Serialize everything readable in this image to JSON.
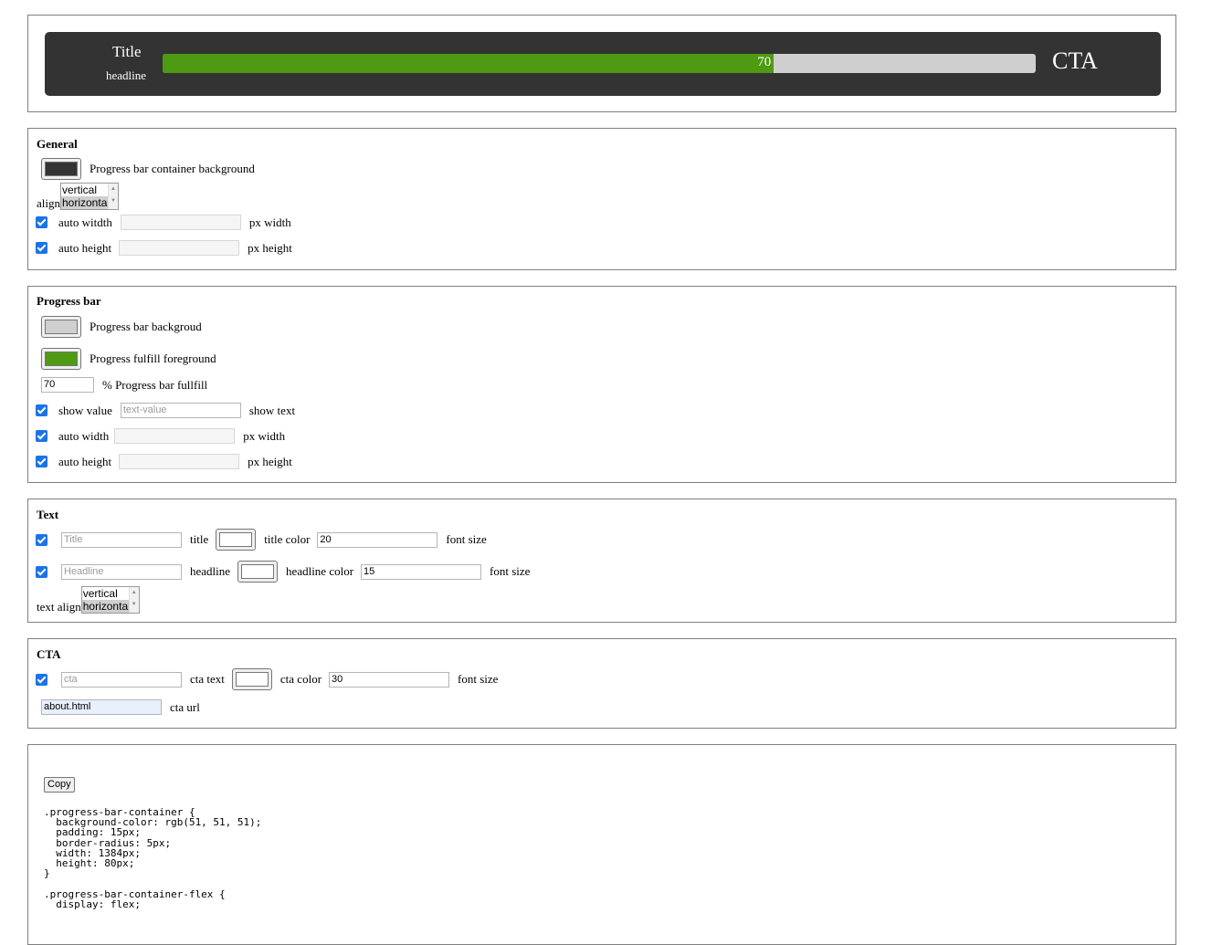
{
  "preview": {
    "title": "Title",
    "headline": "headline",
    "value": "70",
    "fill_percent": 70,
    "cta": "CTA",
    "colors": {
      "container": "#333333",
      "track": "#cfcfcf",
      "fill": "#4e9a13",
      "text": "#ffffff"
    }
  },
  "general": {
    "legend": "General",
    "container_bg_label": "Progress bar container background",
    "container_bg_color": "#333333",
    "align_label": "align",
    "align_options": [
      "vertical",
      "horizontal"
    ],
    "align_selected": "horizontal",
    "auto_width_label": "auto witdth",
    "px_width_label": "px width",
    "auto_height_label": "auto height",
    "px_height_label": "px height"
  },
  "progress": {
    "legend": "Progress bar",
    "bg_label": "Progress bar backgroud",
    "bg_color": "#cfcfcf",
    "fg_label": "Progress fulfill foreground",
    "fg_color": "#4e9a13",
    "fullfill_value": "70",
    "fullfill_label": "% Progress bar fullfill",
    "show_value_label": "show value",
    "text_value_placeholder": "text-value",
    "show_text_label": "show text",
    "auto_width_label": "auto width",
    "px_width_label": "px width",
    "auto_height_label": "auto height",
    "px_height_label": "px height"
  },
  "text": {
    "legend": "Text",
    "title_placeholder": "Title",
    "title_label": "title",
    "title_color_label": "title color",
    "title_font_size": "20",
    "font_size_label": "font size",
    "headline_placeholder": "Headline",
    "headline_label": "headline",
    "headline_color_label": "headline color",
    "headline_font_size": "15",
    "text_align_label": "text align",
    "align_options": [
      "vertical",
      "horizontal"
    ],
    "align_selected": "horizontal"
  },
  "cta": {
    "legend": "CTA",
    "cta_placeholder": "cta",
    "cta_text_label": "cta text",
    "cta_color_label": "cta color",
    "cta_font_size": "30",
    "font_size_label": "font size",
    "url_value": "about.html",
    "url_label": "cta url"
  },
  "output": {
    "copy_label": "Copy",
    "code": ".progress-bar-container {\n  background-color: rgb(51, 51, 51);\n  padding: 15px;\n  border-radius: 5px;\n  width: 1384px;\n  height: 80px;\n}\n\n.progress-bar-container-flex {\n  display: flex;"
  }
}
